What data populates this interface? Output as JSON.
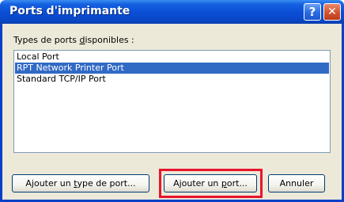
{
  "window": {
    "title": "Ports d'imprimante",
    "help_symbol": "?",
    "close_symbol": "✕"
  },
  "types_label": {
    "before": "Types de ports ",
    "accel": "d",
    "after": "isponibles :"
  },
  "port_list": {
    "items": [
      {
        "label": "Local Port",
        "selected": false
      },
      {
        "label": "RPT Network Printer Port",
        "selected": true
      },
      {
        "label": "Standard TCP/IP Port",
        "selected": false
      }
    ]
  },
  "buttons": {
    "add_type": {
      "before": "Ajouter un ",
      "accel": "t",
      "after": "ype de port..."
    },
    "add_port": {
      "before": "Ajouter un ",
      "accel": "p",
      "after": "ort..."
    },
    "cancel": {
      "label": "Annuler"
    }
  },
  "colors": {
    "selection": "#316ac5",
    "highlight_box": "#e8142d"
  }
}
